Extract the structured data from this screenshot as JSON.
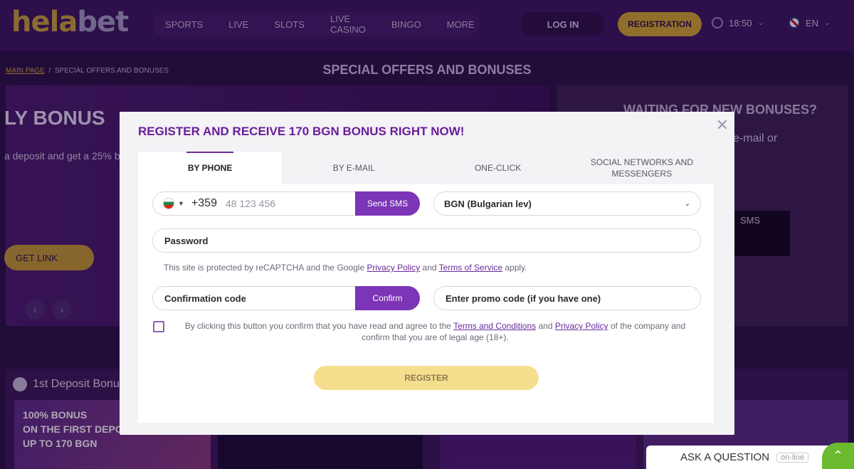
{
  "header": {
    "logo_part1": "hela",
    "logo_part2": "bet",
    "nav": [
      "SPORTS",
      "LIVE",
      "SLOTS",
      "LIVE CASINO",
      "BINGO",
      "MORE"
    ],
    "login_label": "LOG IN",
    "register_label": "REGISTRATION",
    "time": "18:50",
    "language": "EN"
  },
  "breadcrumb": {
    "home": "MAIN PAGE",
    "separator": "/",
    "current": "SPECIAL OFFERS AND BONUSES"
  },
  "page_title": "SPECIAL OFFERS AND BONUSES",
  "hero": {
    "title_fragment": "LY BONUS",
    "subtitle_fragment": "a deposit and get a 25% b",
    "get_link_label": "GET LINK"
  },
  "side_panel": {
    "title": "WAITING FOR NEW BONUSES?",
    "text_fragment": "e-mail or",
    "sms_label": "SMS"
  },
  "bottom": {
    "section_label": "1st Deposit Bonu",
    "promo_lines": [
      "100% BONUS",
      "ON THE FIRST DEPO",
      "UP TO 170 BGN"
    ]
  },
  "modal": {
    "title": "REGISTER AND RECEIVE 170 BGN BONUS RIGHT NOW!",
    "tabs": [
      "BY PHONE",
      "BY E-MAIL",
      "ONE-CLICK",
      "SOCIAL NETWORKS AND MESSENGERS"
    ],
    "phone_code": "+359",
    "phone_placeholder": "48 123 456",
    "send_sms_label": "Send SMS",
    "currency": "BGN (Bulgarian lev)",
    "password_label": "Password",
    "recaptcha_prefix": "This site is protected by reCAPTCHA and the Google",
    "privacy_policy": "Privacy Policy",
    "recaptcha_and": "and",
    "terms_of_service": "Terms of Service",
    "recaptcha_suffix": "apply.",
    "confirmation_label": "Confirmation code",
    "confirm_label": "Confirm",
    "promo_label": "Enter promo code (if you have one)",
    "consent_prefix": "By clicking this button you confirm that you have read and agree to the",
    "terms_and_conditions": "Terms and Conditions",
    "consent_and": "and",
    "consent_privacy": "Privacy Policy",
    "consent_suffix": "of the company and confirm that you are of legal age (18+).",
    "register_label": "REGISTER"
  },
  "ask_widget": {
    "label": "ASK A QUESTION",
    "status": "on-line"
  }
}
